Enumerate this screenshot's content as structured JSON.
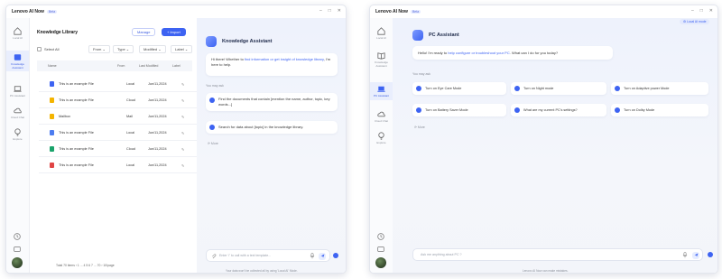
{
  "app": {
    "title": "Lenovo AI Now",
    "beta": "Beta"
  },
  "window_controls": [
    "–",
    "□",
    "✕"
  ],
  "sidebar": {
    "items": [
      {
        "label": "Local AI"
      },
      {
        "label": "Knowledge Assistant"
      },
      {
        "label": "PC Assistant"
      },
      {
        "label": "Cloud Chat"
      },
      {
        "label": "Explore"
      }
    ]
  },
  "library": {
    "title": "Knowledge Library",
    "manage_label": "Manage",
    "import_label": "+ Import",
    "select_all": "Select All",
    "filters": [
      "From ⌄",
      "Type ⌄",
      "Modified ⌄",
      "Label ⌄"
    ],
    "columns": [
      "Name",
      "From",
      "Last Modified",
      "Label"
    ],
    "rows": [
      {
        "name": "This is an example File",
        "from": "Local",
        "modified": "Jun/11,2024",
        "icon_color": "#3d63f2"
      },
      {
        "name": "This is an example File",
        "from": "Cloud",
        "modified": "Jun/11,2024",
        "icon_color": "#f4b400"
      },
      {
        "name": "Mailbox",
        "from": "Mail",
        "modified": "Jun/11,2024",
        "icon_color": "#f4b400"
      },
      {
        "name": "This is an example File",
        "from": "Local",
        "modified": "Jun/11,2024",
        "icon_color": "#4c7cf0"
      },
      {
        "name": "This is an example File",
        "from": "Cloud",
        "modified": "Jun/11,2024",
        "icon_color": "#1aa36b"
      },
      {
        "name": "This is an example File",
        "from": "Local",
        "modified": "Jun/11,2024",
        "icon_color": "#e04444"
      }
    ],
    "pager": "Total 70 items   ‹   1   ...   4   5   6   7   ...   70   ›   10/page"
  },
  "knowledge_chat": {
    "title": "Knowledge Assistant",
    "greeting_pre": "Hi there! Whether to ",
    "greeting_link": "find information or get insight of knowledge library",
    "greeting_post": ", I'm here to help.",
    "you_may_ask": "You may ask",
    "suggestions": [
      "Find the documents that contain [mention the name, author, topic, key words...]",
      "Search for data about [topic] in the knowledge library."
    ],
    "more": "More",
    "input_placeholder": "Enter '/' to call with a text template...",
    "footer": "Your data won't be collected all by using 'Local AI' Mode."
  },
  "pc_chat": {
    "local_badge": "Local AI mode",
    "title": "PC Assistant",
    "greeting_pre": "Hello!  I'm ready to ",
    "greeting_link": "help configure or troubleshoot your PC",
    "greeting_post": ".   What can I do for you today?",
    "you_may_ask": "You may ask",
    "suggestions": [
      "Turn on Eye Care Mode",
      "Turn on Night mode",
      "Turn on Adaptive power Mode",
      "Turn on Battery Saver Mode",
      "What are my current PC's settings?",
      "Turn on Dolby Mode"
    ],
    "more": "More",
    "input_placeholder": "Ask me anything about PC ?",
    "footer": "Lenovo AI Now can make mistakes."
  }
}
